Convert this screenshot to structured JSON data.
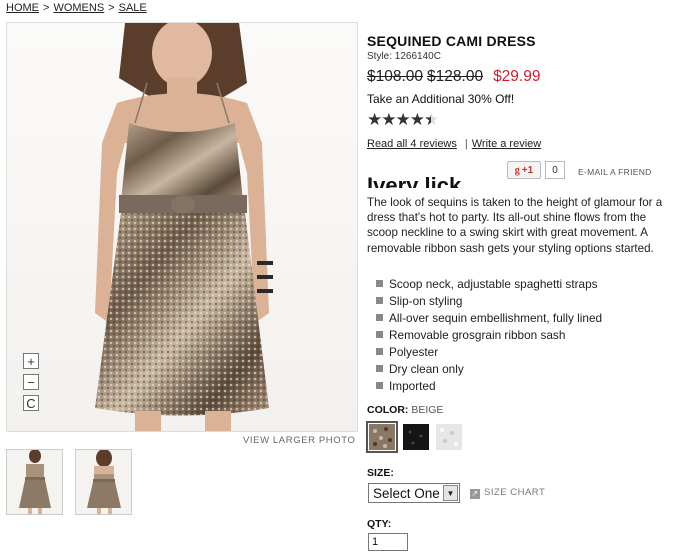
{
  "breadcrumb": {
    "home": "HOME",
    "womens": "WOMENS",
    "sale": "SALE",
    "sep": ">"
  },
  "product": {
    "title": "SEQUINED CAMI DRESS",
    "style": "Style: 1266140C",
    "price_old_1": "$108.00",
    "price_old_2": "$128.00",
    "price_sale": "$29.99",
    "promo": "Take an Additional 30% Off!",
    "rating": 4.5,
    "rating_stars": "★★★★★",
    "read_reviews": "Read all 4 reviews",
    "write_review": "Write a review",
    "gplus_label": "+1",
    "gplus_count": "0",
    "email_friend": "E-MAIL A FRIEND",
    "cut_heading": "Ivery lick",
    "description": "The look of sequins is taken to the height of glamour for a dress that's hot to party. Its all-out shine flows from the scoop neckline to a swing skirt with great movement. A removable ribbon sash gets your styling options started.",
    "features": [
      "Scoop neck, adjustable spaghetti straps",
      "Slip-on styling",
      "All-over sequin embellishment, fully lined",
      "Removable grosgrain ribbon sash",
      "Polyester",
      "Dry clean only",
      "Imported"
    ]
  },
  "photo": {
    "view_larger": "VIEW LARGER PHOTO",
    "zoom_in": "+",
    "zoom_out": "−",
    "reset": "C"
  },
  "color": {
    "label": "COLOR:",
    "value": "BEIGE",
    "swatches": [
      "#8a7866",
      "#151515",
      "#e6e6e6"
    ]
  },
  "size": {
    "label": "SIZE:",
    "selected": "Select One",
    "chart": "SIZE CHART"
  },
  "qty": {
    "label": "QTY:",
    "value": "1"
  }
}
